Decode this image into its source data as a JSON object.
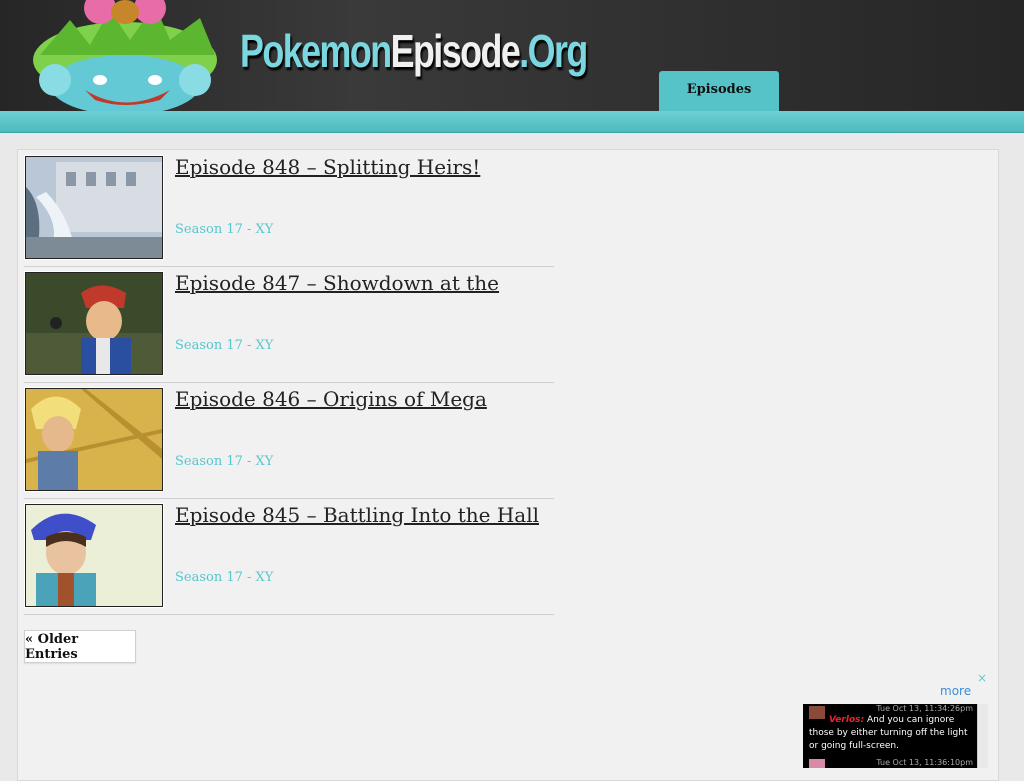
{
  "site": {
    "logo_part1": "Pokemon",
    "logo_part2": "Episode",
    "logo_part3": ".Org"
  },
  "nav": {
    "tab_label": "Episodes"
  },
  "posts": [
    {
      "title": "Episode 848 – Splitting Heirs!",
      "category": "Season 17 - XY"
    },
    {
      "title": "Episode 847 – Showdown at the",
      "category": "Season 17 - XY"
    },
    {
      "title": "Episode 846 – Origins of Mega",
      "category": "Season 17 - XY"
    },
    {
      "title": "Episode 845 – Battling Into the Hall",
      "category": "Season 17 - XY"
    }
  ],
  "pagination": {
    "older_label": "« Older Entries"
  },
  "chat": {
    "close": "×",
    "more": "more",
    "timestamp": "Tue Oct 13, 11:34:26pm",
    "user": "Verlos:",
    "message": "And you can ignore those by either turning off the light or going full-screen.",
    "timestamp2": "Tue Oct 13, 11:36:10pm"
  }
}
